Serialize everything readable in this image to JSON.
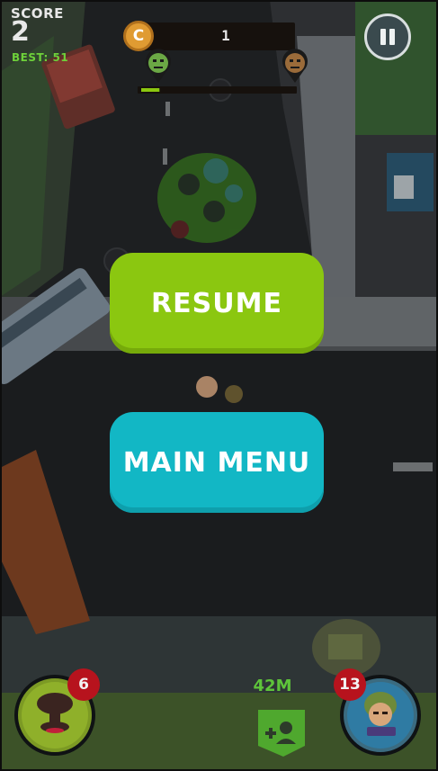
{
  "hud": {
    "score_label": "SCORE",
    "score_value": "2",
    "best_text": "BEST: 51",
    "coin_symbol": "C",
    "coin_count": "1"
  },
  "progress": {
    "fraction": 0.12
  },
  "menu": {
    "resume_label": "RESUME",
    "main_menu_label": "MAIN MENU"
  },
  "powerups": {
    "nuke_count": "6",
    "soldier_count": "13",
    "distance": "42M"
  },
  "icons": [
    "pause-icon",
    "coin-icon",
    "zombie-marker-icon",
    "soldier-marker-icon",
    "nuke-icon",
    "soldier-icon",
    "add-friend-icon"
  ],
  "colors": {
    "resume": "#8bc710",
    "main_menu": "#12b7c5",
    "badge": "#b7131d",
    "best": "#6ed13a"
  }
}
